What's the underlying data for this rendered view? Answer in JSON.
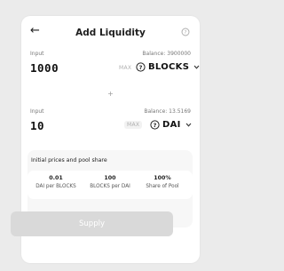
{
  "header": {
    "back_icon": "arrow-left-icon",
    "title": "Add Liquidity",
    "help_icon": "question-circle-icon"
  },
  "input_top": {
    "label": "Input",
    "balance": "Balance: 3900000",
    "amount": "1000",
    "max_label": "MAX",
    "token_icon": "question-circle-icon",
    "token": "BLOCKS"
  },
  "separator": "+",
  "input_bottom": {
    "label": "Input",
    "balance": "Balance: 13.5169",
    "amount": "10",
    "max_label": "MAX",
    "token_icon": "question-circle-icon",
    "token": "DAI"
  },
  "prices": {
    "title": "Initial prices and pool share",
    "stats": [
      {
        "value": "0.01",
        "label": "DAI per BLOCKS"
      },
      {
        "value": "100",
        "label": "BLOCKS per DAI"
      },
      {
        "value": "100%",
        "label": "Share of Pool"
      }
    ]
  },
  "supply_button": "Supply",
  "colors": {
    "background": "#ebebeb",
    "card": "#ffffff",
    "button_disabled": "#d9d9d9",
    "muted_text": "#b0b0b0"
  }
}
